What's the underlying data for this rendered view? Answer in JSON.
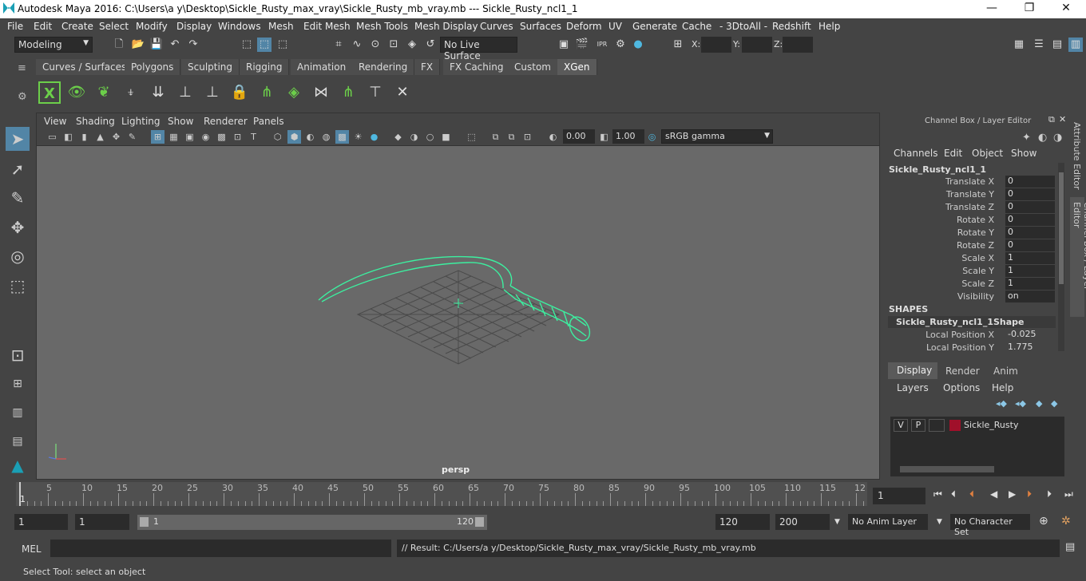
{
  "window": {
    "title": "Autodesk Maya 2016: C:\\Users\\a y\\Desktop\\Sickle_Rusty_max_vray\\Sickle_Rusty_mb_vray.mb   ---   Sickle_Rusty_ncl1_1",
    "minimize": "—",
    "maximize": "❐",
    "close": "✕"
  },
  "menu": [
    "File",
    "Edit",
    "Create",
    "Select",
    "Modify",
    "Display",
    "Windows",
    "Mesh",
    "Edit Mesh",
    "Mesh Tools",
    "Mesh Display",
    "Curves",
    "Surfaces",
    "Deform",
    "UV",
    "Generate",
    "Cache",
    "- 3DtoAll -",
    "Redshift",
    "Help"
  ],
  "status": {
    "mode": "Modeling",
    "live_surface": "No Live Surface",
    "x_label": "X:",
    "y_label": "Y:",
    "z_label": "Z:"
  },
  "shelf_tabs": [
    "Curves / Surfaces",
    "Polygons",
    "Sculpting",
    "Rigging",
    "Animation",
    "Rendering",
    "FX",
    "FX Caching",
    "Custom",
    "XGen"
  ],
  "active_shelf_tab": "XGen",
  "viewport": {
    "menu": [
      "View",
      "Shading",
      "Lighting",
      "Show",
      "Renderer",
      "Panels"
    ],
    "exposure": "0.00",
    "gamma": "1.00",
    "color_space": "sRGB gamma",
    "camera_label": "persp"
  },
  "channel_box": {
    "header": "Channel Box / Layer Editor",
    "menu": [
      "Channels",
      "Edit",
      "Object",
      "Show"
    ],
    "object_name": "Sickle_Rusty_ncl1_1",
    "channels": [
      {
        "name": "Translate X",
        "value": "0"
      },
      {
        "name": "Translate Y",
        "value": "0"
      },
      {
        "name": "Translate Z",
        "value": "0"
      },
      {
        "name": "Rotate X",
        "value": "0"
      },
      {
        "name": "Rotate Y",
        "value": "0"
      },
      {
        "name": "Rotate Z",
        "value": "0"
      },
      {
        "name": "Scale X",
        "value": "1"
      },
      {
        "name": "Scale Y",
        "value": "1"
      },
      {
        "name": "Scale Z",
        "value": "1"
      },
      {
        "name": "Visibility",
        "value": "on"
      }
    ],
    "shapes_header": "SHAPES",
    "shape_name": "Sickle_Rusty_ncl1_1Shape",
    "shape_channels": [
      {
        "name": "Local Position X",
        "value": "-0.025"
      },
      {
        "name": "Local Position Y",
        "value": "1.775"
      }
    ]
  },
  "layer_editor": {
    "tabs": [
      "Display",
      "Render",
      "Anim"
    ],
    "active_tab": "Display",
    "menu": [
      "Layers",
      "Options",
      "Help"
    ],
    "layer": {
      "v": "V",
      "p": "P",
      "name": "Sickle_Rusty",
      "color": "#a0102a"
    }
  },
  "side_tabs": {
    "attribute_editor": "Attribute Editor",
    "channel_box": "Channel Box / Layer Editor"
  },
  "timeline": {
    "ticks": [
      "5",
      "10",
      "15",
      "20",
      "25",
      "30",
      "35",
      "40",
      "45",
      "50",
      "55",
      "60",
      "65",
      "70",
      "75",
      "80",
      "85",
      "90",
      "95",
      "100",
      "105",
      "110",
      "115",
      "12"
    ],
    "first": "1",
    "current_frame": "1"
  },
  "range": {
    "start": "1",
    "playback_start": "1",
    "slider_start": "1",
    "slider_end": "120",
    "playback_end": "120",
    "end": "200",
    "anim_layer": "No Anim Layer",
    "char_set": "No Character Set"
  },
  "mel": {
    "label": "MEL",
    "result": "// Result: C:/Users/a y/Desktop/Sickle_Rusty_max_vray/Sickle_Rusty_mb_vray.mb"
  },
  "help_line": "Select Tool: select an object",
  "colors": {
    "accent": "#5285a6",
    "wire": "#3cf0a0"
  }
}
